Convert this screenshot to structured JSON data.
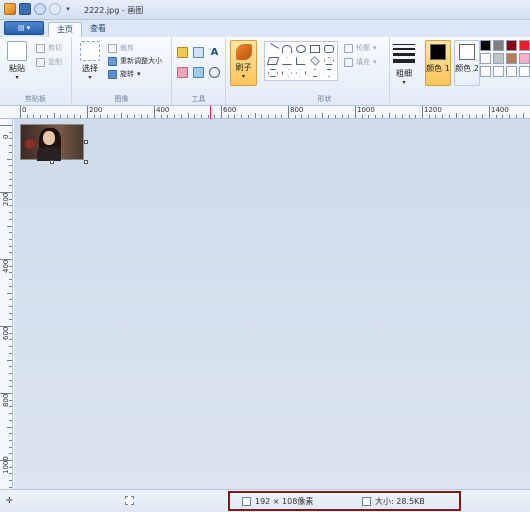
{
  "window": {
    "title": "2222.jpg - 画图"
  },
  "menu_button": "▤ ▾",
  "tabs": [
    {
      "label": "主页"
    },
    {
      "label": "查看"
    }
  ],
  "ribbon": {
    "clipboard": {
      "paste": "粘贴",
      "cut": "剪切",
      "copy": "复制",
      "label": "剪贴板"
    },
    "image": {
      "select": "选择",
      "crop": "裁剪",
      "resize": "重新调整大小",
      "rotate": "旋转",
      "label": "图像"
    },
    "tools": {
      "label": "工具"
    },
    "brushes": {
      "label": "刷子"
    },
    "shapes": {
      "outline": "轮廓",
      "fill": "填充",
      "label": "形状"
    },
    "size": {
      "label": "粗细"
    },
    "color1": {
      "label": "颜色 1"
    },
    "color2": {
      "label": "颜色 2"
    },
    "palette": [
      "#000000",
      "#7f7f7f",
      "#880015",
      "#ed1c24",
      "#ffffff",
      "#c3c3c3",
      "#b97a57",
      "#ffaec9",
      "#ffffff",
      "#ffffff",
      "#ffffff",
      "#ffffff"
    ]
  },
  "ruler": {
    "top": [
      "0",
      "200",
      "400",
      "600",
      "800",
      "1000",
      "1200",
      "1400"
    ],
    "left": [
      "0",
      "200",
      "400",
      "600",
      "800",
      "1000"
    ]
  },
  "status": {
    "dimensions": "192 × 108像素",
    "size": "大小: 28.5KB"
  }
}
